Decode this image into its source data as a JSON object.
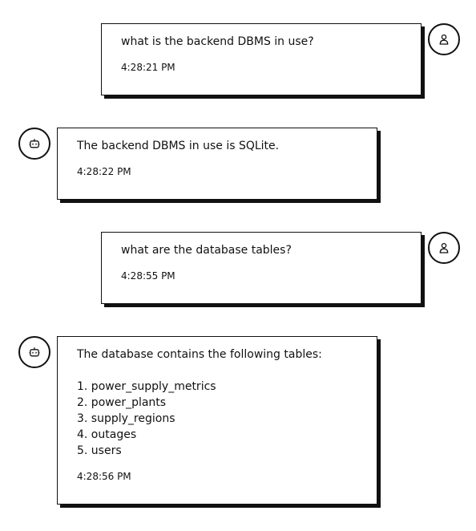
{
  "messages": [
    {
      "role": "user",
      "avatar_icon": "user-icon",
      "text": "what is the backend DBMS in use?",
      "time": "4:28:21 PM"
    },
    {
      "role": "bot",
      "avatar_icon": "bot-icon",
      "text": "The backend DBMS in use is SQLite.",
      "time": "4:28:22 PM"
    },
    {
      "role": "user",
      "avatar_icon": "user-icon",
      "text": "what are the database tables?",
      "time": "4:28:55 PM"
    },
    {
      "role": "bot",
      "avatar_icon": "bot-icon",
      "intro": "The database contains the following tables:",
      "list": [
        "1. power_supply_metrics",
        "2. power_plants",
        "3. supply_regions",
        "4. outages",
        "5. users"
      ],
      "time": "4:28:56 PM"
    }
  ],
  "colors": {
    "ink": "#111111",
    "background": "#ffffff"
  }
}
